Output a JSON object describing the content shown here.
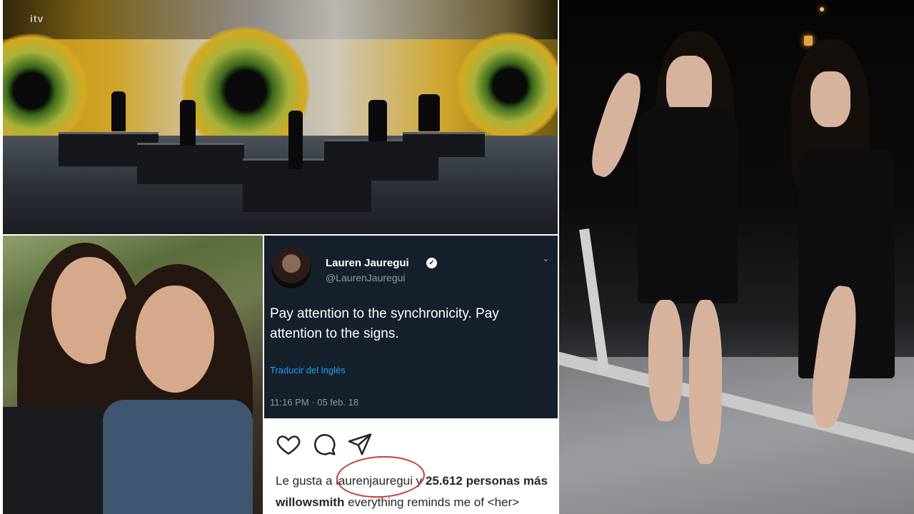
{
  "stage": {
    "logo": "itv"
  },
  "tweet": {
    "name": "Lauren Jauregui",
    "handle": "@LaurenJauregui",
    "text": "Pay attention to the synchronicity. Pay attention to the signs.",
    "translate_label": "Traducir del inglés",
    "timestamp": "11:16 PM · 05 feb. 18",
    "verified_icon": "verified-badge-icon",
    "menu_icon": "chevron-down-icon",
    "colors": {
      "background": "#15202b",
      "link": "#1da1f2",
      "muted": "#8899a6"
    }
  },
  "instagram": {
    "icons": [
      "heart-icon",
      "comment-icon",
      "share-icon"
    ],
    "likes_prefix": "Le gusta a",
    "liked_by": "laurenjauregui",
    "likes_joiner": "y",
    "likes_count": "25.612 personas más",
    "caption_user": "willowsmith",
    "caption_text": "everything reminds me of <her>",
    "highlight_color": "#c63d3d"
  }
}
